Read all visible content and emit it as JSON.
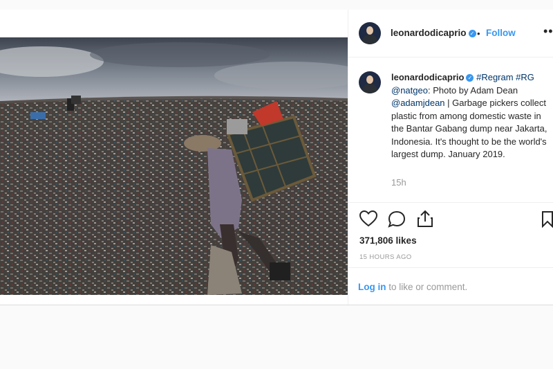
{
  "post": {
    "username": "leonardodicaprio",
    "follow_label": "Follow",
    "separator": "•",
    "more_label": "•••",
    "caption": {
      "username": "leonardodicaprio",
      "tags": "#Regram #RG",
      "mention": "@natgeo",
      "colon": ":",
      "text_before": "Photo by Adam Dean ",
      "photographer": "@adamjdean",
      "text_after": " | Garbage pickers collect plastic from among domestic waste in the Bantar Gabang dump near Jakarta, Indonesia. It's thought to be the world's largest dump. January 2019."
    },
    "time_short": "15h",
    "likes": "371,806 likes",
    "time_ago": "15 HOURS AGO",
    "login_link": "Log in",
    "login_text": " to like or comment."
  },
  "icons": {
    "like": "heart-icon",
    "comment": "comment-icon",
    "share": "share-icon",
    "save": "bookmark-icon",
    "verified": "verified-badge-icon"
  },
  "colors": {
    "link_blue": "#3897f0",
    "text": "#262626",
    "muted": "#999999"
  }
}
